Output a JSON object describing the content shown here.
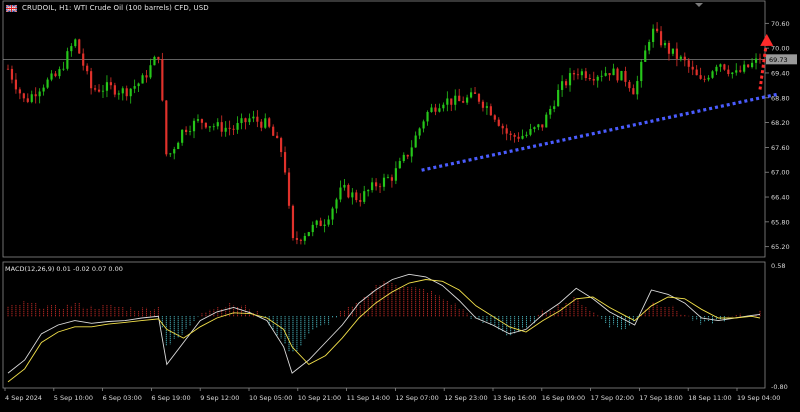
{
  "header": {
    "symbol_line": "CRUDOIL, H1:  WTI Crude Oil (100 barrels) CFD, USD",
    "flag_icon": "uk-flag-icon"
  },
  "chart_data": [
    {
      "type": "candlestick",
      "title": "CRUDOIL, H1:  WTI Crude Oil (100 barrels) CFD, USD",
      "ylim": [
        64.95,
        70.85
      ],
      "y_ticks": [
        "70.60",
        "70.00",
        "69.40",
        "68.80",
        "68.20",
        "67.60",
        "67.00",
        "66.40",
        "65.80",
        "65.20"
      ],
      "current_price": "69.73",
      "current_price_value": 69.73,
      "up_color": "#26c71a",
      "down_color": "#e0312b",
      "x_ticks": [
        "4 Sep 2024",
        "5 Sep 10:00",
        "6 Sep 03:00",
        "6 Sep 19:00",
        "9 Sep 12:00",
        "10 Sep 05:00",
        "10 Sep 21:00",
        "11 Sep 14:00",
        "12 Sep 07:00",
        "12 Sep 23:00",
        "13 Sep 16:00",
        "16 Sep 09:00",
        "17 Sep 02:00",
        "17 Sep 18:00",
        "18 Sep 11:00",
        "19 Sep 04:00"
      ],
      "close_path": [
        [
          0,
          69.5
        ],
        [
          4,
          68.7
        ],
        [
          8,
          69.1
        ],
        [
          12,
          69.35
        ],
        [
          16,
          70.2
        ],
        [
          20,
          69.0
        ],
        [
          24,
          69.05
        ],
        [
          28,
          68.95
        ],
        [
          32,
          69.2
        ],
        [
          36,
          69.85
        ],
        [
          38,
          67.3
        ],
        [
          42,
          68.05
        ],
        [
          46,
          68.25
        ],
        [
          50,
          68.1
        ],
        [
          54,
          68.05
        ],
        [
          58,
          68.3
        ],
        [
          62,
          68.15
        ],
        [
          66,
          67.4
        ],
        [
          68,
          65.3
        ],
        [
          72,
          65.6
        ],
        [
          76,
          65.85
        ],
        [
          80,
          66.6
        ],
        [
          84,
          66.35
        ],
        [
          88,
          66.7
        ],
        [
          92,
          66.9
        ],
        [
          96,
          67.5
        ],
        [
          100,
          68.4
        ],
        [
          104,
          68.75
        ],
        [
          108,
          68.7
        ],
        [
          112,
          68.85
        ],
        [
          116,
          68.45
        ],
        [
          120,
          67.85
        ],
        [
          124,
          67.9
        ],
        [
          128,
          68.15
        ],
        [
          132,
          69.0
        ],
        [
          136,
          69.45
        ],
        [
          140,
          69.35
        ],
        [
          144,
          69.45
        ],
        [
          148,
          69.25
        ],
        [
          150,
          68.95
        ],
        [
          154,
          70.45
        ],
        [
          158,
          69.95
        ],
        [
          162,
          69.65
        ],
        [
          166,
          69.15
        ],
        [
          170,
          69.7
        ],
        [
          174,
          69.35
        ],
        [
          178,
          69.6
        ],
        [
          180,
          69.73
        ]
      ],
      "trendline": {
        "from": [
          99,
          67.05
        ],
        "to": [
          184,
          68.88
        ],
        "color": "#4a5cff",
        "style": "dotted"
      },
      "arrow": {
        "from": [
          180,
          69.0
        ],
        "to": [
          181.5,
          70.25
        ],
        "color": "#ff2a2a",
        "style": "dotted",
        "meaning": "upward projection"
      }
    },
    {
      "type": "macd",
      "title": "MACD(12,26,9) 0.01 -0.02 0.07 0.00",
      "params": [
        12,
        26,
        9
      ],
      "readings": [
        0.01,
        -0.02,
        0.07,
        0.0
      ],
      "ylim": [
        -0.82,
        0.62
      ],
      "y_ticks": [
        "0.58",
        "-0.80"
      ],
      "histogram": [
        [
          0,
          0.1
        ],
        [
          4,
          0.15
        ],
        [
          8,
          0.12
        ],
        [
          12,
          0.1
        ],
        [
          16,
          0.14
        ],
        [
          20,
          0.1
        ],
        [
          24,
          0.12
        ],
        [
          28,
          0.09
        ],
        [
          32,
          0.08
        ],
        [
          36,
          0.1
        ],
        [
          38,
          -0.35
        ],
        [
          42,
          -0.2
        ],
        [
          46,
          0.05
        ],
        [
          50,
          0.1
        ],
        [
          54,
          0.13
        ],
        [
          58,
          0.09
        ],
        [
          62,
          -0.05
        ],
        [
          66,
          -0.3
        ],
        [
          68,
          -0.45
        ],
        [
          72,
          -0.2
        ],
        [
          76,
          -0.1
        ],
        [
          80,
          0.05
        ],
        [
          84,
          0.14
        ],
        [
          88,
          0.35
        ],
        [
          92,
          0.4
        ],
        [
          96,
          0.32
        ],
        [
          100,
          0.3
        ],
        [
          104,
          0.2
        ],
        [
          108,
          0.1
        ],
        [
          112,
          -0.05
        ],
        [
          116,
          -0.1
        ],
        [
          120,
          -0.22
        ],
        [
          124,
          -0.15
        ],
        [
          128,
          0.05
        ],
        [
          132,
          0.12
        ],
        [
          136,
          0.2
        ],
        [
          140,
          0.05
        ],
        [
          144,
          -0.1
        ],
        [
          148,
          -0.15
        ],
        [
          150,
          -0.05
        ],
        [
          154,
          0.16
        ],
        [
          158,
          0.12
        ],
        [
          162,
          0.02
        ],
        [
          166,
          -0.1
        ],
        [
          170,
          -0.05
        ],
        [
          174,
          0.0
        ],
        [
          178,
          0.01
        ],
        [
          180,
          0.07
        ]
      ],
      "macd_line": [
        [
          0,
          -0.65
        ],
        [
          4,
          -0.5
        ],
        [
          8,
          -0.2
        ],
        [
          12,
          -0.1
        ],
        [
          16,
          -0.05
        ],
        [
          20,
          -0.08
        ],
        [
          24,
          -0.06
        ],
        [
          28,
          -0.05
        ],
        [
          32,
          -0.02
        ],
        [
          36,
          0.0
        ],
        [
          38,
          -0.55
        ],
        [
          42,
          -0.3
        ],
        [
          46,
          -0.05
        ],
        [
          50,
          0.05
        ],
        [
          54,
          0.1
        ],
        [
          58,
          0.04
        ],
        [
          62,
          -0.05
        ],
        [
          66,
          -0.35
        ],
        [
          68,
          -0.65
        ],
        [
          72,
          -0.5
        ],
        [
          76,
          -0.3
        ],
        [
          80,
          -0.1
        ],
        [
          84,
          0.15
        ],
        [
          88,
          0.3
        ],
        [
          92,
          0.42
        ],
        [
          96,
          0.48
        ],
        [
          100,
          0.45
        ],
        [
          104,
          0.35
        ],
        [
          108,
          0.18
        ],
        [
          112,
          -0.02
        ],
        [
          116,
          -0.1
        ],
        [
          120,
          -0.2
        ],
        [
          124,
          -0.15
        ],
        [
          128,
          0.02
        ],
        [
          132,
          0.15
        ],
        [
          136,
          0.32
        ],
        [
          140,
          0.2
        ],
        [
          144,
          0.05
        ],
        [
          148,
          -0.05
        ],
        [
          150,
          -0.1
        ],
        [
          154,
          0.3
        ],
        [
          158,
          0.25
        ],
        [
          162,
          0.15
        ],
        [
          166,
          -0.02
        ],
        [
          170,
          -0.05
        ],
        [
          174,
          -0.02
        ],
        [
          178,
          0.01
        ],
        [
          180,
          0.02
        ]
      ],
      "signal_line": [
        [
          0,
          -0.75
        ],
        [
          4,
          -0.6
        ],
        [
          8,
          -0.3
        ],
        [
          12,
          -0.18
        ],
        [
          16,
          -0.12
        ],
        [
          20,
          -0.12
        ],
        [
          24,
          -0.09
        ],
        [
          28,
          -0.07
        ],
        [
          32,
          -0.05
        ],
        [
          36,
          -0.03
        ],
        [
          38,
          -0.15
        ],
        [
          42,
          -0.25
        ],
        [
          46,
          -0.12
        ],
        [
          50,
          -0.02
        ],
        [
          54,
          0.04
        ],
        [
          58,
          0.03
        ],
        [
          62,
          -0.02
        ],
        [
          66,
          -0.15
        ],
        [
          68,
          -0.35
        ],
        [
          72,
          -0.55
        ],
        [
          76,
          -0.45
        ],
        [
          80,
          -0.25
        ],
        [
          84,
          -0.02
        ],
        [
          88,
          0.15
        ],
        [
          92,
          0.28
        ],
        [
          96,
          0.38
        ],
        [
          100,
          0.42
        ],
        [
          104,
          0.4
        ],
        [
          108,
          0.3
        ],
        [
          112,
          0.12
        ],
        [
          116,
          0.0
        ],
        [
          120,
          -0.12
        ],
        [
          124,
          -0.18
        ],
        [
          128,
          -0.05
        ],
        [
          132,
          0.06
        ],
        [
          136,
          0.2
        ],
        [
          140,
          0.22
        ],
        [
          144,
          0.1
        ],
        [
          148,
          0.0
        ],
        [
          150,
          -0.05
        ],
        [
          154,
          0.12
        ],
        [
          158,
          0.22
        ],
        [
          162,
          0.2
        ],
        [
          166,
          0.08
        ],
        [
          170,
          -0.02
        ],
        [
          174,
          -0.02
        ],
        [
          178,
          0.0
        ],
        [
          180,
          -0.02
        ]
      ],
      "hist_pos_color": "#e0312b",
      "hist_neg_color": "#56d6e0",
      "macd_color": "#dcdcdc",
      "signal_color": "#f2e04a"
    }
  ]
}
